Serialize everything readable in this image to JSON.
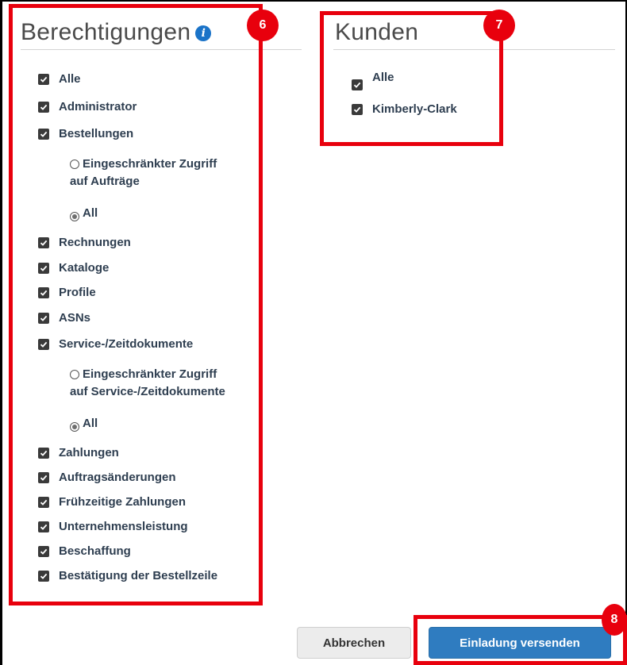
{
  "permissions": {
    "title": "Berechtigungen",
    "info_icon": "info-icon",
    "items": [
      {
        "label": "Alle",
        "checked": true
      },
      {
        "label": "Administrator",
        "checked": true
      },
      {
        "label": "Bestellungen",
        "checked": true
      },
      {
        "label": "Rechnungen",
        "checked": true
      },
      {
        "label": "Kataloge",
        "checked": true
      },
      {
        "label": "Profile",
        "checked": true
      },
      {
        "label": "ASNs",
        "checked": true
      },
      {
        "label": "Service-/Zeitdokumente",
        "checked": true
      },
      {
        "label": "Zahlungen",
        "checked": true
      },
      {
        "label": "Auftragsänderungen",
        "checked": true
      },
      {
        "label": "Frühzeitige Zahlungen",
        "checked": true
      },
      {
        "label": "Unternehmensleistung",
        "checked": true
      },
      {
        "label": "Beschaffung",
        "checked": true
      },
      {
        "label": "Bestätigung der Bestellzeile",
        "checked": true
      }
    ],
    "orders_options": {
      "restricted_line1": "Eingeschränkter Zugriff",
      "restricted_line2": "auf Aufträge",
      "all": "All",
      "selected": "All"
    },
    "service_options": {
      "restricted_line1": "Eingeschränkter Zugriff",
      "restricted_line2": "auf Service-/Zeitdokumente",
      "all": "All",
      "selected": "All"
    }
  },
  "customers": {
    "title": "Kunden",
    "items": [
      {
        "label": "Alle",
        "checked": true
      },
      {
        "label": "Kimberly-Clark",
        "checked": true
      }
    ]
  },
  "callouts": {
    "permissions": "6",
    "customers": "7",
    "send": "8"
  },
  "buttons": {
    "cancel": "Abbrechen",
    "send": "Einladung versenden"
  },
  "colors": {
    "callout": "#e8000d",
    "primary": "#2f7cc0",
    "info": "#1a73c8"
  }
}
